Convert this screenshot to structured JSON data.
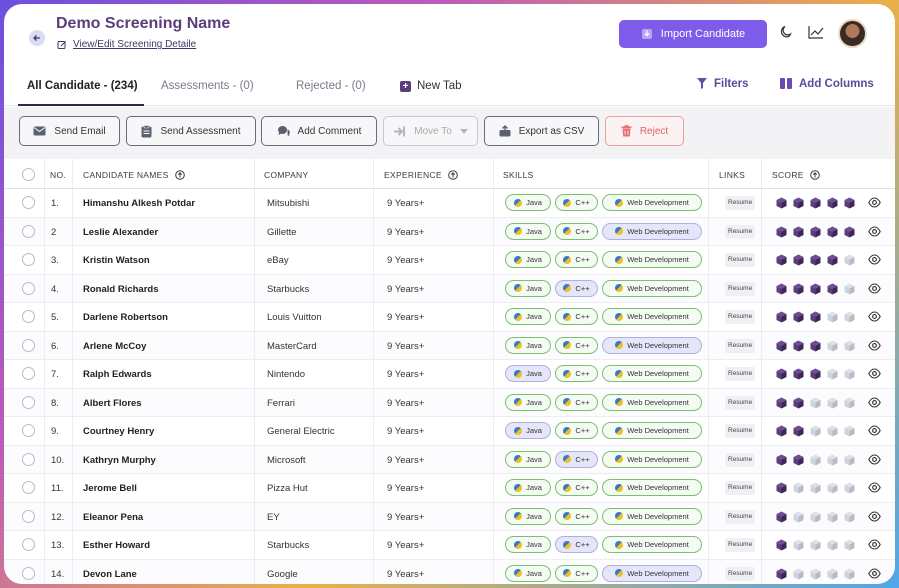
{
  "header": {
    "title": "Demo Screening Name",
    "edit_link": "View/Edit Screening Detaile",
    "import_label": "Import Candidate"
  },
  "tabs": [
    {
      "label": "All Candidate - (234)"
    },
    {
      "label": "Assessments - (0)"
    },
    {
      "label": "Rejected - (0)"
    },
    {
      "label": "New Tab"
    }
  ],
  "toolbar_right": {
    "filters": "Filters",
    "add_columns": "Add Columns"
  },
  "actions": {
    "send_email": "Send Email",
    "send_assessment": "Send Assessment",
    "add_comment": "Add Comment",
    "move_to": "Move To",
    "export_csv": "Export as CSV",
    "reject": "Reject"
  },
  "columns": {
    "no": "NO.",
    "name": "CANDIDATE NAMES",
    "company": "COMPANY",
    "experience": "EXPERIENCE",
    "skills": "SKILLS",
    "links": "LINKS",
    "score": "SCORE"
  },
  "skill_labels": [
    "Java",
    "C++",
    "Web Development"
  ],
  "resume_label": "Resume",
  "colors": {
    "accent": "#7c5ce8",
    "cube_on": "#5a3d7a",
    "cube_off": "#cfd3dc"
  },
  "rows": [
    {
      "no": "1.",
      "name": "Himanshu Alkesh Potdar",
      "company": "Mitsubishi",
      "experience": "9 Years+",
      "hl": [
        false,
        false,
        false
      ],
      "score": 5
    },
    {
      "no": "2",
      "name": "Leslie Alexander",
      "company": "Gillette",
      "experience": "9 Years+",
      "hl": [
        false,
        false,
        true
      ],
      "score": 5
    },
    {
      "no": "3.",
      "name": "Kristin Watson",
      "company": "eBay",
      "experience": "9 Years+",
      "hl": [
        false,
        false,
        false
      ],
      "score": 4
    },
    {
      "no": "4.",
      "name": "Ronald Richards",
      "company": "Starbucks",
      "experience": "9 Years+",
      "hl": [
        false,
        true,
        false
      ],
      "score": 4
    },
    {
      "no": "5.",
      "name": "Darlene Robertson",
      "company": "Louis Vuitton",
      "experience": "9 Years+",
      "hl": [
        false,
        false,
        false
      ],
      "score": 3
    },
    {
      "no": "6.",
      "name": "Arlene McCoy",
      "company": "MasterCard",
      "experience": "9 Years+",
      "hl": [
        false,
        false,
        true
      ],
      "score": 3
    },
    {
      "no": "7.",
      "name": "Ralph Edwards",
      "company": "Nintendo",
      "experience": "9 Years+",
      "hl": [
        true,
        false,
        false
      ],
      "score": 3
    },
    {
      "no": "8.",
      "name": "Albert Flores",
      "company": "Ferrari",
      "experience": "9 Years+",
      "hl": [
        false,
        false,
        false
      ],
      "score": 2
    },
    {
      "no": "9.",
      "name": "Courtney Henry",
      "company": "General Electric",
      "experience": "9 Years+",
      "hl": [
        true,
        false,
        false
      ],
      "score": 2
    },
    {
      "no": "10.",
      "name": "Kathryn Murphy",
      "company": "Microsoft",
      "experience": "9 Years+",
      "hl": [
        false,
        true,
        false
      ],
      "score": 2
    },
    {
      "no": "11.",
      "name": "Jerome Bell",
      "company": "Pizza Hut",
      "experience": "9 Years+",
      "hl": [
        false,
        false,
        false
      ],
      "score": 1
    },
    {
      "no": "12.",
      "name": "Eleanor Pena",
      "company": "EY",
      "experience": "9 Years+",
      "hl": [
        false,
        false,
        false
      ],
      "score": 1
    },
    {
      "no": "13.",
      "name": "Esther Howard",
      "company": "Starbucks",
      "experience": "9 Years+",
      "hl": [
        false,
        true,
        false
      ],
      "score": 1
    },
    {
      "no": "14.",
      "name": "Devon Lane",
      "company": "Google",
      "experience": "9 Years+",
      "hl": [
        false,
        false,
        true
      ],
      "score": 1
    }
  ]
}
